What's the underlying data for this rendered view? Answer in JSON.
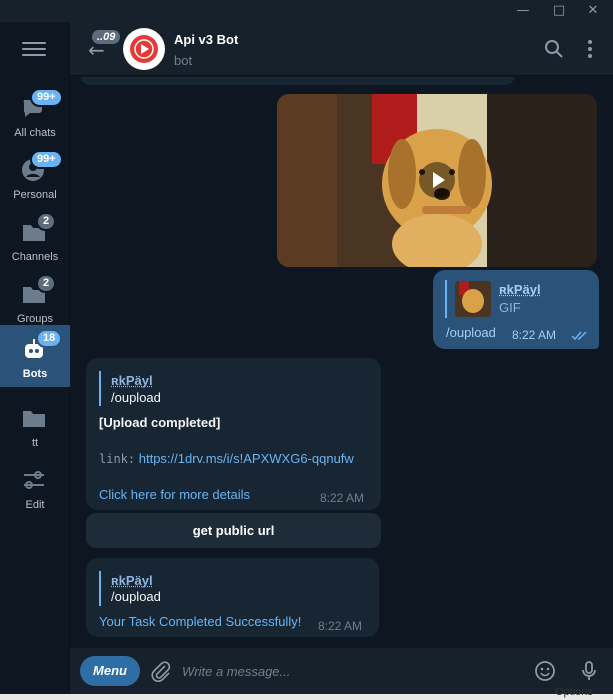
{
  "window": {
    "controls": [
      "minimize",
      "maximize",
      "close"
    ]
  },
  "sidebar": {
    "items": [
      {
        "label": "All chats",
        "badge": "99+",
        "icon": "chat-bubbles-icon"
      },
      {
        "label": "Personal",
        "badge": "99+",
        "icon": "person-icon"
      },
      {
        "label": "Channels",
        "badge": "2",
        "icon": "megaphone-icon"
      },
      {
        "label": "Groups",
        "badge": "2",
        "icon": "group-folder-icon"
      },
      {
        "label": "Bots",
        "badge": "18",
        "icon": "bot-icon",
        "active": true
      },
      {
        "label": "tt",
        "icon": "folder-icon"
      },
      {
        "label": "Edit",
        "icon": "sliders-icon"
      }
    ]
  },
  "header": {
    "unread_count": "..09",
    "title": "Api v3 Bot",
    "subtitle": "bot"
  },
  "messages": {
    "outgoing": {
      "reply_name": "ʀkPäyl",
      "reply_type": "GIF",
      "text": "/oupload",
      "time": "8:22 AM"
    },
    "incoming1": {
      "reply_name": "ʀkPäyl",
      "reply_text": "/oupload",
      "title": "[Upload completed]",
      "link_label": "link:",
      "link_url": "https://1drv.ms/i/s!APXWXG6-qqnufw",
      "details": "Click here for more details",
      "time": "8:22 AM"
    },
    "inline_button": "get public url",
    "incoming2": {
      "reply_name": "ʀkPäyl",
      "reply_text": "/oupload",
      "text": "Your Task Completed Successfully!",
      "time": "8:22 AM"
    }
  },
  "composer": {
    "menu_label": "Menu",
    "placeholder": "Write a message..."
  },
  "background_window": {
    "options_text": "Options"
  },
  "colors": {
    "accent": "#6ab3f3",
    "active_folder": "#2b5278",
    "outgoing_bubble": "#2b5278",
    "incoming_bubble": "#182533"
  }
}
